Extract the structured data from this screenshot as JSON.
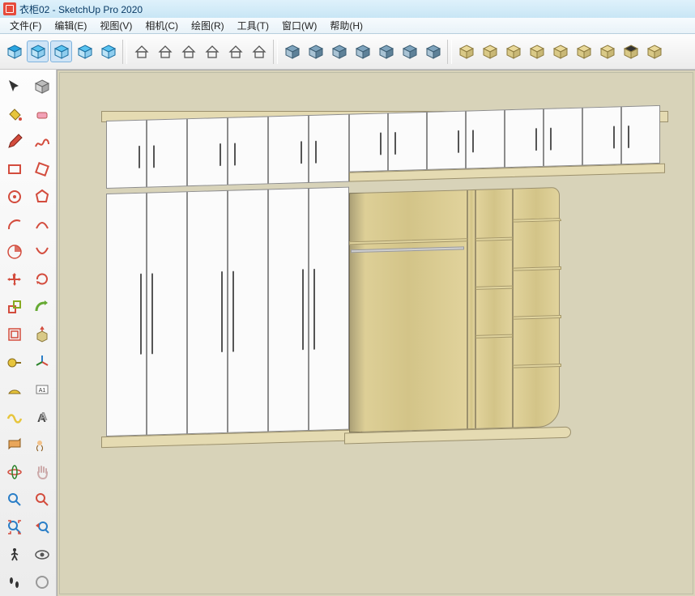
{
  "titlebar": {
    "text": "衣柜02 - SketchUp Pro 2020"
  },
  "menu": {
    "file": "文件(F)",
    "edit": "编辑(E)",
    "view": "视图(V)",
    "camera": "相机(C)",
    "draw": "绘图(R)",
    "tools": "工具(T)",
    "window": "窗口(W)",
    "help": "帮助(H)"
  },
  "toolbar_top": [
    "iso-view",
    "view-front",
    "view-back",
    "view-left",
    "view-right",
    "SEP",
    "style-wire",
    "style-hidden",
    "style-shaded",
    "style-shaded-tex",
    "style-mono",
    "style-xray",
    "SEP",
    "shadow",
    "fog",
    "edge",
    "profile",
    "backedge",
    "xray2",
    "sun",
    "SEP",
    "layer-a",
    "layer-b",
    "layer-c",
    "layer-d",
    "layer-e",
    "layer-f",
    "layer-g",
    "layer-h",
    "layer-i"
  ],
  "active_top": [
    "view-front",
    "view-back"
  ],
  "side_tools": [
    [
      "select",
      "make-component"
    ],
    [
      "paint-bucket",
      "eraser"
    ],
    [
      "pencil",
      "freehand"
    ],
    [
      "rectangle",
      "rotated-rectangle"
    ],
    [
      "circle",
      "polygon"
    ],
    [
      "arc",
      "two-point-arc"
    ],
    [
      "pie",
      "three-point-arc"
    ],
    [
      "move",
      "rotate"
    ],
    [
      "scale",
      "follow-me"
    ],
    [
      "offset",
      "push-pull"
    ],
    [
      "tape-measure",
      "axes"
    ],
    [
      "protractor",
      "dimension"
    ],
    [
      "text",
      "three-d-text"
    ],
    [
      "section-plane",
      "position-camera"
    ],
    [
      "orbit",
      "pan"
    ],
    [
      "zoom",
      "zoom-window"
    ],
    [
      "zoom-extents",
      "previous-view"
    ],
    [
      "walk",
      "look-around"
    ],
    [
      "footprints",
      "unknown"
    ]
  ]
}
